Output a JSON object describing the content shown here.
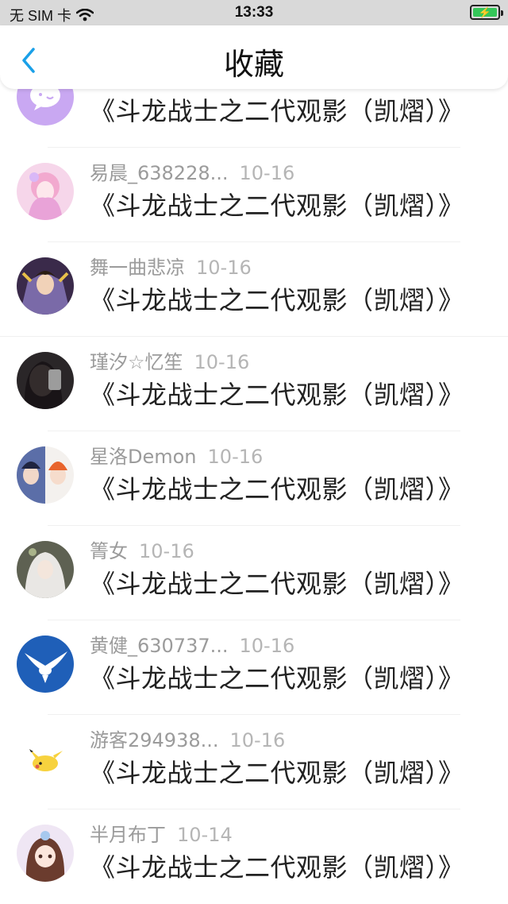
{
  "status_bar": {
    "carrier": "无 SIM 卡",
    "time": "13:33"
  },
  "nav": {
    "title": "收藏"
  },
  "items": [
    {
      "author": "",
      "date": "",
      "title": "《斗龙战士之二代观影（凯熠）》"
    },
    {
      "author": "易晨_638228...",
      "date": "10-16",
      "title": "《斗龙战士之二代观影（凯熠）》"
    },
    {
      "author": "舞一曲悲凉",
      "date": "10-16",
      "title": "《斗龙战士之二代观影（凯熠）》"
    },
    {
      "author": "瑾汐☆忆笙",
      "date": "10-16",
      "title": "《斗龙战士之二代观影（凯熠）》"
    },
    {
      "author": "星洛Demon",
      "date": "10-16",
      "title": "《斗龙战士之二代观影（凯熠）》"
    },
    {
      "author": "箐女",
      "date": "10-16",
      "title": "《斗龙战士之二代观影（凯熠）》"
    },
    {
      "author": "黄健_630737...",
      "date": "10-16",
      "title": "《斗龙战士之二代观影（凯熠）》"
    },
    {
      "author": "游客294938...",
      "date": "10-16",
      "title": "《斗龙战士之二代观影（凯熠）》"
    },
    {
      "author": "半月布丁",
      "date": "10-14",
      "title": "《斗龙战士之二代观影（凯熠）》"
    }
  ],
  "colors": {
    "accent": "#1aa0e8",
    "battery": "#35c759"
  }
}
